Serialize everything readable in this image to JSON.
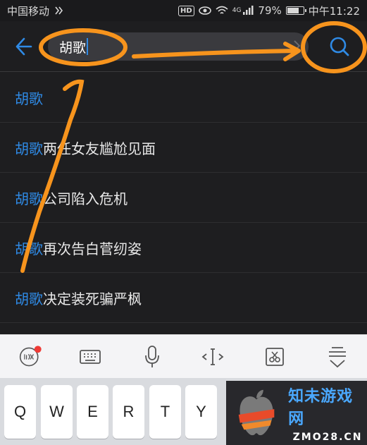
{
  "status_bar": {
    "carrier": "中国移动",
    "hd": "HD",
    "network": "4G",
    "battery": "79%",
    "battery_level": 0.79,
    "time": "中午11:22"
  },
  "search": {
    "query": "胡歌"
  },
  "suggestions": [
    {
      "highlight": "胡歌",
      "rest": ""
    },
    {
      "highlight": "胡歌",
      "rest": "两任女友尴尬见面"
    },
    {
      "highlight": "胡歌",
      "rest": "公司陷入危机"
    },
    {
      "highlight": "胡歌",
      "rest": "再次告白菅纫姿"
    },
    {
      "highlight": "胡歌",
      "rest": "决定装死骗严枫"
    }
  ],
  "keyboard": {
    "toolbar_icons": [
      "ifly-logo-icon",
      "keyboard-icon",
      "microphone-icon",
      "cursor-icon",
      "clipboard-icon",
      "hide-keyboard-icon"
    ],
    "keys": [
      "Q",
      "W",
      "E",
      "R",
      "T",
      "Y"
    ]
  },
  "watermark": {
    "title": "知未游戏网",
    "url": "ZMO28.CN"
  },
  "colors": {
    "accent": "#2f8ae5",
    "annotation": "#f7941d"
  }
}
